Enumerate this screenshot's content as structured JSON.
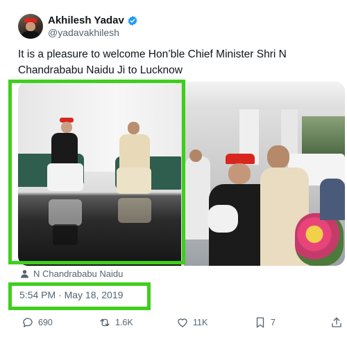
{
  "author": {
    "display_name": "Akhilesh Yadav",
    "handle": "@yadavakhilesh",
    "verified": true
  },
  "tweet": {
    "text": "It is a pleasure to welcome Hon’ble Chief Minister Shri N Chandrababu Naidu Ji to Lucknow",
    "tagged_user": "N Chandrababu Naidu",
    "timestamp": "5:54 PM · May 18, 2019"
  },
  "actions": {
    "replies": "690",
    "reposts": "1.6K",
    "likes": "11K",
    "bookmarks": "7"
  },
  "colors": {
    "highlight": "#3ecf1b",
    "verified_blue": "#1d9bf0",
    "muted_text": "#536471"
  },
  "icons": [
    "verified-badge-icon",
    "person-icon",
    "reply-icon",
    "repost-icon",
    "like-icon",
    "bookmark-icon",
    "share-icon"
  ]
}
